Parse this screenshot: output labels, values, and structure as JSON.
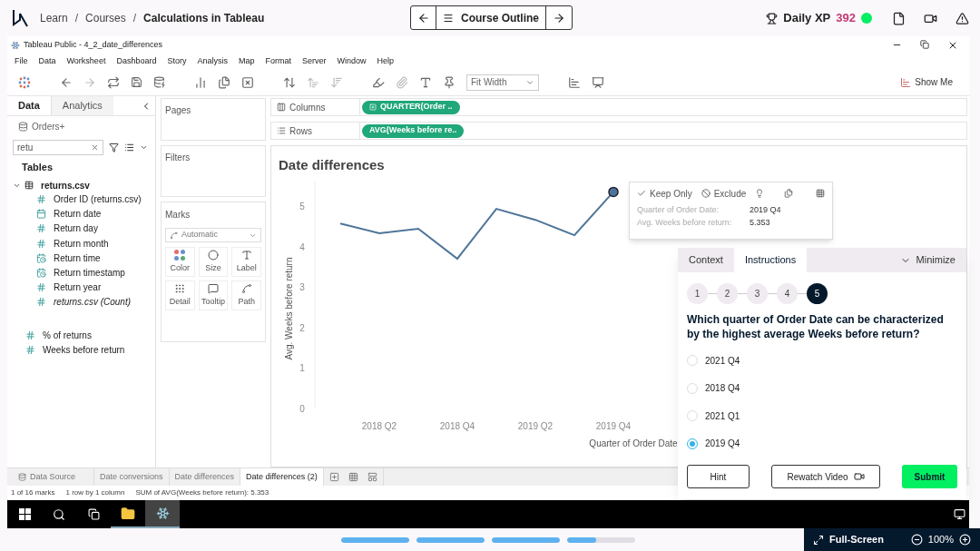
{
  "header": {
    "separator": "/",
    "breadcrumbs": [
      {
        "label": "Learn",
        "kind": "link"
      },
      {
        "label": "Courses",
        "kind": "link"
      },
      {
        "label": "Calculations in Tableau",
        "kind": "current"
      }
    ],
    "outline_button": "Course Outline",
    "xp_label": "Daily XP",
    "xp_value": "392"
  },
  "window": {
    "title": "Tableau Public - 4_2_date_differences"
  },
  "menu": [
    "File",
    "Data",
    "Worksheet",
    "Dashboard",
    "Story",
    "Analysis",
    "Map",
    "Format",
    "Server",
    "Window",
    "Help"
  ],
  "toolbar": {
    "fit": "Fit Width",
    "show_me": "Show Me"
  },
  "data_pane": {
    "tabs": [
      {
        "label": "Data",
        "selected": true
      },
      {
        "label": "Analytics",
        "selected": false
      }
    ],
    "source": "Orders+",
    "search": "retu",
    "tables_heading": "Tables",
    "table": {
      "name": "returns.csv",
      "expanded": true,
      "children": [
        {
          "name": "Order ID (returns.csv)",
          "kind": "number"
        },
        {
          "name": "Return date",
          "kind": "date"
        },
        {
          "name": "Return day",
          "kind": "number"
        },
        {
          "name": "Return month",
          "kind": "number"
        },
        {
          "name": "Return time",
          "kind": "datetime"
        },
        {
          "name": "Return timestamp",
          "kind": "datetime"
        },
        {
          "name": "Return year",
          "kind": "number"
        },
        {
          "name": "returns.csv (Count)",
          "kind": "count"
        }
      ]
    },
    "calculated": [
      "% of returns",
      "Weeks before return"
    ]
  },
  "shelves": {
    "pages": "Pages",
    "filters": "Filters",
    "marks": {
      "title": "Marks",
      "type": "Automatic",
      "cards": [
        {
          "label": "Color",
          "kind": "color"
        },
        {
          "label": "Size",
          "kind": "size"
        },
        {
          "label": "Label",
          "kind": "label"
        },
        {
          "label": "Detail",
          "kind": "detail"
        },
        {
          "label": "Tooltip",
          "kind": "tooltip"
        },
        {
          "label": "Path",
          "kind": "path"
        }
      ]
    }
  },
  "columns": {
    "label": "Columns",
    "pill": "QUARTER(Order .."
  },
  "rows": {
    "label": "Rows",
    "pill": "AVG(Weeks before re.."
  },
  "sheet": {
    "title": "Date differences",
    "chart_data": {
      "type": "line",
      "xlabel": "Quarter of Order Date",
      "ylabel": "Avg. Weeks before return",
      "categories": [
        null,
        "2018 Q2",
        null,
        "2018 Q4",
        null,
        "2019 Q2",
        null,
        "2019 Q4"
      ],
      "series": [
        {
          "color": "#4e7598",
          "values": [
            4.57,
            4.33,
            4.44,
            3.7,
            4.93,
            4.66,
            4.28,
            5.35
          ]
        }
      ],
      "yticks": [
        0,
        1,
        2,
        3,
        4,
        5
      ],
      "ylim": [
        0,
        5.6
      ]
    },
    "tooltip": {
      "actions": [
        "Keep Only",
        "Exclude"
      ],
      "rows": [
        {
          "label": "Quarter of Order Date:",
          "value": "2019 Q4"
        },
        {
          "label": "Avg. Weeks before return:",
          "value": "5.353"
        }
      ]
    }
  },
  "sheet_tabs": [
    {
      "label": "Data Source",
      "selected": false
    },
    {
      "label": "Date conversions",
      "selected": false
    },
    {
      "label": "Date differences",
      "selected": false
    },
    {
      "label": "Date differences (2)",
      "selected": true
    }
  ],
  "status_bar": [
    "1 of 16 marks",
    "1 row by 1 column",
    "SUM of AVG(Weeks before return): 5.353"
  ],
  "instructions_panel": {
    "tabs": [
      {
        "label": "Context",
        "selected": false
      },
      {
        "label": "Instructions",
        "selected": true
      }
    ],
    "minimize": "Minimize",
    "steps": [
      {
        "label": "1",
        "selected": false
      },
      {
        "label": "2",
        "selected": false
      },
      {
        "label": "3",
        "selected": false
      },
      {
        "label": "4",
        "selected": false
      },
      {
        "label": "5",
        "selected": true
      }
    ],
    "question": "Which quarter of Order Date can be characterized by the highest average Weeks before return?",
    "options": [
      {
        "label": "2021 Q4",
        "selected": false
      },
      {
        "label": "2018 Q4",
        "selected": false
      },
      {
        "label": "2021 Q1",
        "selected": false
      },
      {
        "label": "2019 Q4",
        "selected": true
      }
    ],
    "hint": "Hint",
    "rewatch": "Rewatch Video",
    "submit": "Submit"
  },
  "footer": {
    "progress": [
      {
        "level": 1
      },
      {
        "level": 1
      },
      {
        "level": 1
      },
      {
        "level": 0.42
      }
    ],
    "fullscreen": "Full-Screen",
    "zoom": "100%"
  }
}
